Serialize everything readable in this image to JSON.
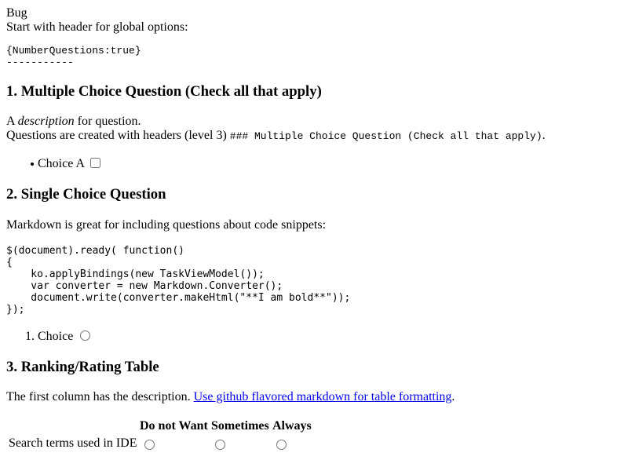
{
  "header": {
    "title": "Bug",
    "intro": "Start with header for global options:",
    "options_code": "{NumberQuestions:true}",
    "separator": "-----------"
  },
  "q1": {
    "heading": "1. Multiple Choice Question (Check all that apply)",
    "desc_prefix": "A ",
    "desc_em": "description",
    "desc_suffix": " for question.",
    "line2_text": "Questions are created with headers (level 3) ",
    "line2_code": "### Multiple Choice Question (Check all that apply)",
    "line2_end": ".",
    "choice_label": "Choice A"
  },
  "q2": {
    "heading": "2. Single Choice Question",
    "desc": "Markdown is great for including questions about code snippets:",
    "code": [
      "$(document).ready( function()",
      "{",
      "    ko.applyBindings(new TaskViewModel());",
      "    var converter = new Markdown.Converter();",
      "    document.write(converter.makeHtml(\"**I am bold**\"));",
      "});"
    ],
    "choice_number": "1.",
    "choice_label": "Choice"
  },
  "q3": {
    "heading": "3. Ranking/Rating Table",
    "desc_prefix": "The first column has the description. ",
    "link_text": "Use github flavored markdown for table formatting",
    "desc_end": ".",
    "columns": [
      "Do not Want",
      "Sometimes",
      "Always"
    ],
    "row_label": "Search terms used in IDE"
  }
}
